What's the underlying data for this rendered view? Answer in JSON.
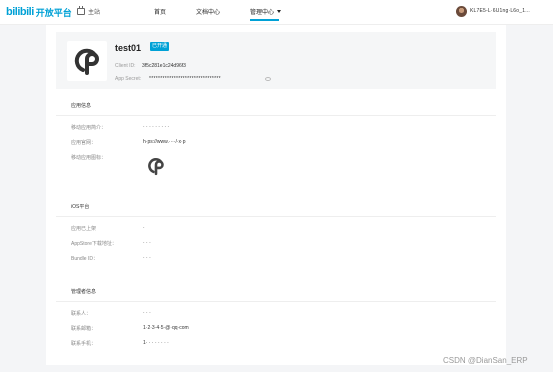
{
  "colors": {
    "accent": "#00a1d6",
    "text": "#333333",
    "muted": "#999999"
  },
  "header": {
    "logo_mark": "bilibili",
    "logo_title": "开放平台",
    "home_label": "主站",
    "home_icon": "tv-icon",
    "nav": {
      "home": "首页",
      "docs": "文档中心",
      "admin": "管理中心"
    },
    "username": "KL7E5-L·6U1ng·L6o_1..."
  },
  "app": {
    "name": "test01",
    "status_badge": "已开通",
    "client_id_label": "Client ID:",
    "client_id_value": "3f5c281e1c24d96f3",
    "secret_label": "App Secret:",
    "secret_value": "********************************"
  },
  "sections": {
    "app_info": {
      "title": "应用信息",
      "intro_label": "移动应用简介：",
      "intro_value": "· · · · · · · · ·",
      "site_label": "应用官网：",
      "site_value": "h·ps://www.····/·x·p",
      "icon_label": "移动应用图标："
    },
    "ios": {
      "title": "iOS平台",
      "online_label": "应用已上架",
      "online_value": "·",
      "appstore_label": "AppStore下载地址：",
      "appstore_value": "· · ·",
      "bundle_label": "Bundle ID：",
      "bundle_value": "· · ·"
    },
    "admin": {
      "title": "管理者信息",
      "contact_label": "联系人：",
      "contact_value": "· · ·",
      "email_label": "联系邮箱：",
      "email_value": "1·2·3·4·5·@·qq·com",
      "phone_label": "联系手机：",
      "phone_value": "1· · · · · · · ·"
    }
  },
  "watermark": "CSDN @DianSan_ERP"
}
